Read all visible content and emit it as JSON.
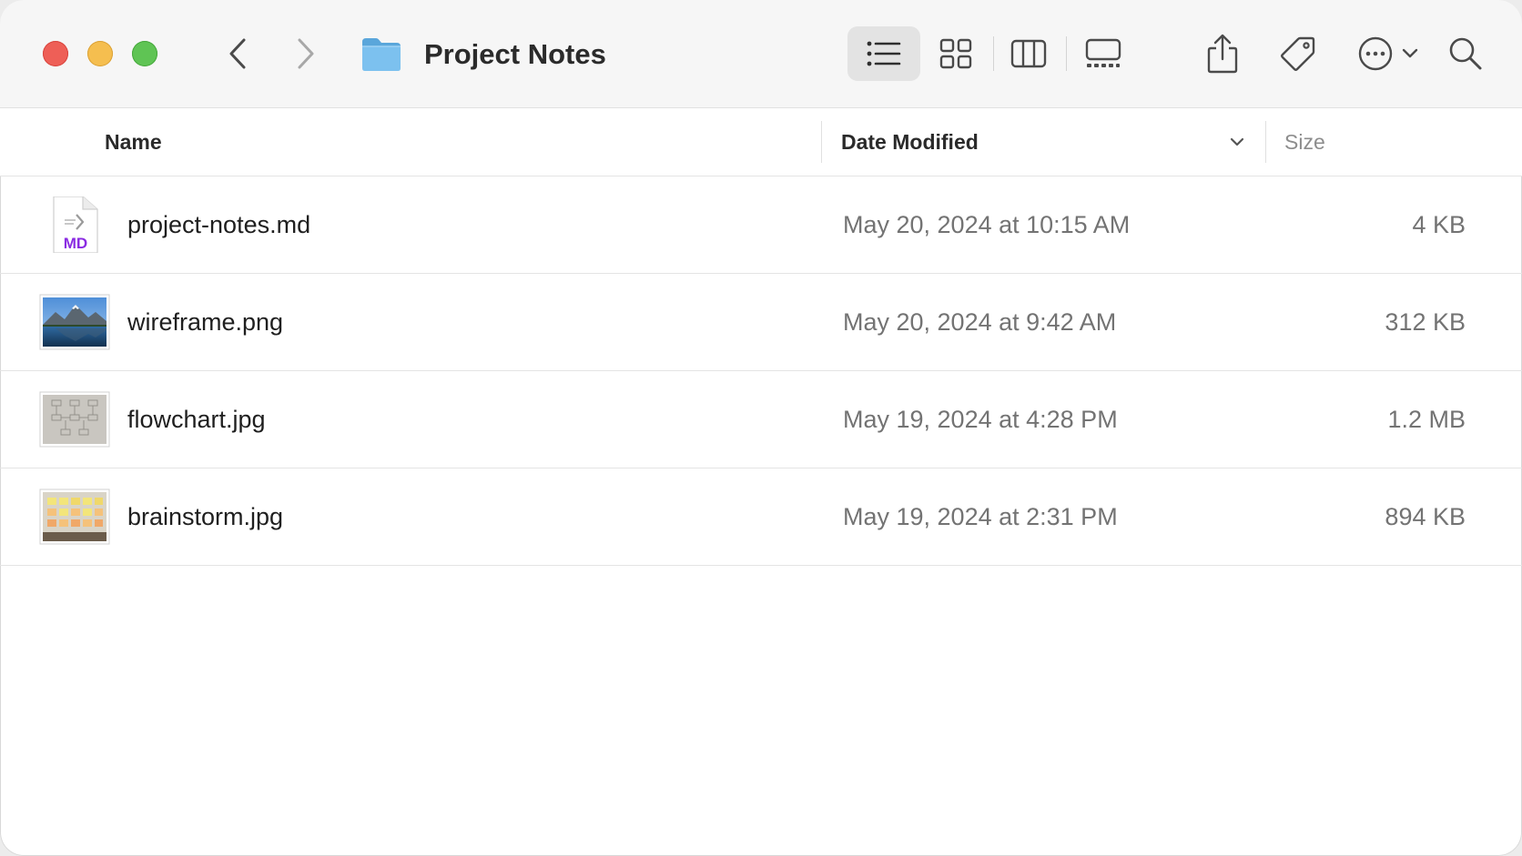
{
  "window": {
    "title": "Project Notes"
  },
  "toolbar": {
    "icons": {
      "back": "chevron-left-icon",
      "forward": "chevron-right-icon",
      "folder": "folder-icon",
      "list_view": "list-view-icon",
      "icon_view": "grid-view-icon",
      "column_view": "column-view-icon",
      "gallery_view": "gallery-view-icon",
      "share": "share-icon",
      "tag": "tag-icon",
      "more": "ellipsis-circle-icon",
      "search": "search-icon"
    },
    "active_view": "list"
  },
  "columns": {
    "name": "Name",
    "date_modified": "Date Modified",
    "size": "Size",
    "sorted_by": "date_modified",
    "sort_direction": "descending"
  },
  "files": [
    {
      "name": "project-notes.md",
      "date": "May 20, 2024 at 10:15 AM",
      "size": "4 KB",
      "icon_badge": "MD",
      "thumbnail": "markdown-file-icon"
    },
    {
      "name": "wireframe.png",
      "date": "May 20, 2024 at 9:42 AM",
      "size": "312 KB",
      "thumbnail": "mountain-lake-thumbnail"
    },
    {
      "name": "flowchart.jpg",
      "date": "May 19, 2024 at 4:28 PM",
      "size": "1.2 MB",
      "thumbnail": "sketch-paper-thumbnail"
    },
    {
      "name": "brainstorm.jpg",
      "date": "May 19, 2024 at 2:31 PM",
      "size": "894 KB",
      "thumbnail": "sticky-notes-thumbnail"
    }
  ],
  "colors": {
    "close": "#ee5f57",
    "minimize": "#f5be4f",
    "zoom": "#5fc454",
    "folder": "#6bb6ea",
    "md_badge": "#8a2be2"
  }
}
